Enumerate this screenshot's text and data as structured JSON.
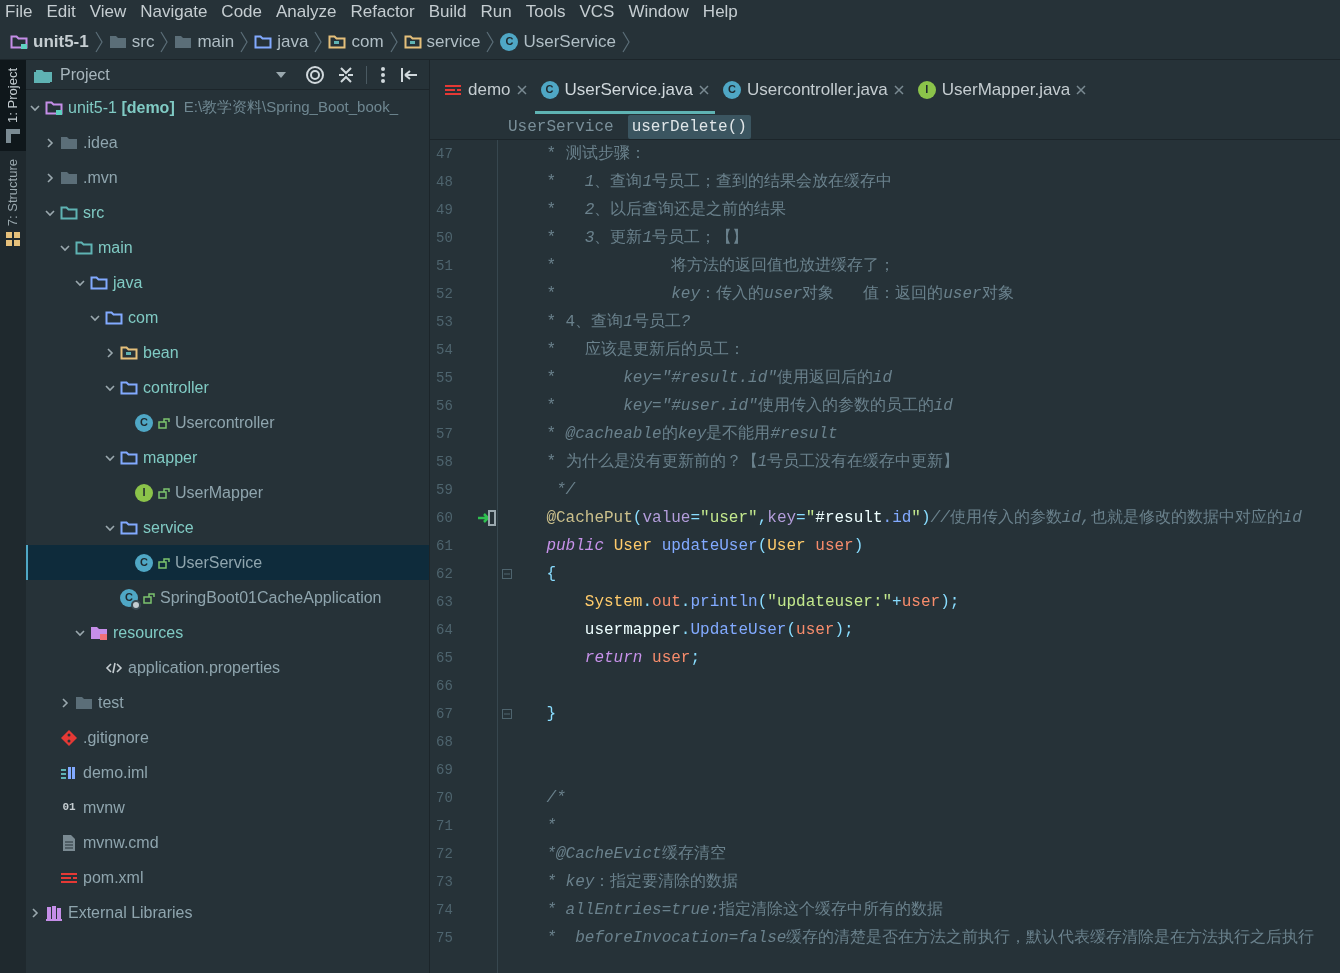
{
  "menu_bar": [
    "File",
    "Edit",
    "View",
    "Navigate",
    "Code",
    "Analyze",
    "Refactor",
    "Build",
    "Run",
    "Tools",
    "VCS",
    "Window",
    "Help"
  ],
  "breadcrumb": [
    {
      "label": "unit5-1",
      "kind": "module"
    },
    {
      "label": "src",
      "kind": "folder"
    },
    {
      "label": "main",
      "kind": "folder"
    },
    {
      "label": "java",
      "kind": "java-folder"
    },
    {
      "label": "com",
      "kind": "package"
    },
    {
      "label": "service",
      "kind": "package"
    },
    {
      "label": "UserService",
      "kind": "class",
      "badge": "C"
    }
  ],
  "side_tabs": [
    {
      "label": "1: Project",
      "selected": true
    },
    {
      "label": "7: Structure",
      "selected": false
    }
  ],
  "project_panel": {
    "title": "Project",
    "tree": [
      {
        "label": "unit5-1 **[demo]**",
        "path": "E:\\教学资料\\Spring_Boot_book_",
        "kind": "module",
        "expanded": true,
        "selected": false,
        "children": [
          {
            "label": ".idea",
            "kind": "folder",
            "expanded": false,
            "selected": false
          },
          {
            "label": ".mvn",
            "kind": "folder",
            "expanded": false,
            "selected": false
          },
          {
            "label": "src",
            "kind": "src-folder",
            "expanded": true,
            "selected": false,
            "children": [
              {
                "label": "main",
                "kind": "src-folder",
                "expanded": true,
                "selected": false,
                "children": [
                  {
                    "label": "java",
                    "kind": "java-folder",
                    "expanded": true,
                    "selected": false,
                    "children": [
                      {
                        "label": "com",
                        "kind": "java-folder",
                        "expanded": true,
                        "selected": false,
                        "children": [
                          {
                            "label": "bean",
                            "kind": "package",
                            "expanded": false,
                            "selected": false
                          },
                          {
                            "label": "controller",
                            "kind": "java-folder",
                            "expanded": true,
                            "selected": false,
                            "children": [
                              {
                                "label": "Usercontroller",
                                "kind": "class",
                                "badge": "C",
                                "selected": false
                              }
                            ]
                          },
                          {
                            "label": "mapper",
                            "kind": "java-folder",
                            "expanded": true,
                            "selected": false,
                            "children": [
                              {
                                "label": "UserMapper",
                                "kind": "interface",
                                "badge": "I",
                                "selected": false
                              }
                            ]
                          },
                          {
                            "label": "service",
                            "kind": "java-folder",
                            "expanded": true,
                            "selected": false,
                            "children": [
                              {
                                "label": "UserService",
                                "kind": "class",
                                "badge": "C",
                                "selected": true
                              }
                            ]
                          },
                          {
                            "label": "SpringBoot01CacheApplication",
                            "kind": "app",
                            "badge": "C",
                            "selected": false
                          }
                        ]
                      }
                    ]
                  },
                  {
                    "label": "resources",
                    "kind": "resources",
                    "expanded": true,
                    "selected": false,
                    "children": [
                      {
                        "label": "application.properties",
                        "kind": "properties",
                        "selected": false
                      }
                    ]
                  }
                ]
              },
              {
                "label": "test",
                "kind": "folder",
                "expanded": false,
                "selected": false
              }
            ]
          },
          {
            "label": ".gitignore",
            "kind": "git",
            "selected": false
          },
          {
            "label": "demo.iml",
            "kind": "iml",
            "selected": false
          },
          {
            "label": "mvnw",
            "kind": "binary",
            "badge": "01",
            "selected": false
          },
          {
            "label": "mvnw.cmd",
            "kind": "file",
            "selected": false
          },
          {
            "label": "pom.xml",
            "kind": "maven",
            "selected": false
          }
        ]
      },
      {
        "label": "External Libraries",
        "kind": "libraries",
        "expanded": false,
        "selected": false
      }
    ]
  },
  "editor": {
    "tabs": [
      {
        "label": "demo",
        "kind": "maven",
        "selected": false
      },
      {
        "label": "UserService.java",
        "kind": "class",
        "badge": "C",
        "selected": true
      },
      {
        "label": "Usercontroller.java",
        "kind": "class",
        "badge": "C",
        "selected": false
      },
      {
        "label": "UserMapper.java",
        "kind": "interface",
        "badge": "I",
        "selected": false
      }
    ],
    "breadcrumb": [
      {
        "label": "UserService",
        "selected": false
      },
      {
        "label": "userDelete()",
        "selected": true
      }
    ],
    "lines": [
      {
        "number": "47",
        "segments": [
          {
            "kind": "comment",
            "text": "    * 测试步骤："
          }
        ]
      },
      {
        "number": "48",
        "segments": [
          {
            "kind": "comment",
            "text": "    *   "
          },
          {
            "kind": "comment_em",
            "text": "1"
          },
          {
            "kind": "comment",
            "text": "、查询"
          },
          {
            "kind": "comment_em",
            "text": "1"
          },
          {
            "kind": "comment",
            "text": "号员工；查到的结果会放在缓存中"
          }
        ]
      },
      {
        "number": "49",
        "segments": [
          {
            "kind": "comment",
            "text": "    *   "
          },
          {
            "kind": "comment_em",
            "text": "2"
          },
          {
            "kind": "comment",
            "text": "、以后查询还是之前的结果"
          }
        ]
      },
      {
        "number": "50",
        "segments": [
          {
            "kind": "comment",
            "text": "    *   "
          },
          {
            "kind": "comment_em",
            "text": "3"
          },
          {
            "kind": "comment",
            "text": "、更新"
          },
          {
            "kind": "comment_em",
            "text": "1"
          },
          {
            "kind": "comment",
            "text": "号员工；【】"
          }
        ]
      },
      {
        "number": "51",
        "segments": [
          {
            "kind": "comment",
            "text": "    *            将方法的返回值也放进缓存了；"
          }
        ]
      },
      {
        "number": "52",
        "segments": [
          {
            "kind": "comment",
            "text": "    *            "
          },
          {
            "kind": "comment_em",
            "text": "key"
          },
          {
            "kind": "comment",
            "text": "：传入的"
          },
          {
            "kind": "comment_em",
            "text": "user"
          },
          {
            "kind": "comment",
            "text": "对象   值：返回的"
          },
          {
            "kind": "comment_em",
            "text": "user"
          },
          {
            "kind": "comment",
            "text": "对象"
          }
        ]
      },
      {
        "number": "53",
        "segments": [
          {
            "kind": "comment",
            "text": "    * 4、查询"
          },
          {
            "kind": "comment_em",
            "text": "1"
          },
          {
            "kind": "comment",
            "text": "号员工"
          },
          {
            "kind": "comment_em",
            "text": "?"
          }
        ]
      },
      {
        "number": "54",
        "segments": [
          {
            "kind": "comment",
            "text": "    *   应该是更新后的员工："
          }
        ]
      },
      {
        "number": "55",
        "segments": [
          {
            "kind": "comment",
            "text": "    *       "
          },
          {
            "kind": "comment_em",
            "text": "key=\"#result.id\""
          },
          {
            "kind": "comment",
            "text": "使用返回后的"
          },
          {
            "kind": "comment_em",
            "text": "id"
          }
        ]
      },
      {
        "number": "56",
        "segments": [
          {
            "kind": "comment",
            "text": "    *       "
          },
          {
            "kind": "comment_em",
            "text": "key=\"#user.id\""
          },
          {
            "kind": "comment",
            "text": "使用传入的参数的员工的"
          },
          {
            "kind": "comment_em",
            "text": "id"
          }
        ]
      },
      {
        "number": "57",
        "segments": [
          {
            "kind": "comment",
            "text": "    * "
          },
          {
            "kind": "comment_em",
            "text": "@cacheable"
          },
          {
            "kind": "comment",
            "text": "的"
          },
          {
            "kind": "comment_em",
            "text": "key"
          },
          {
            "kind": "comment",
            "text": "是不能用"
          },
          {
            "kind": "comment_em",
            "text": "#result"
          }
        ]
      },
      {
        "number": "58",
        "segments": [
          {
            "kind": "comment",
            "text": "    * 为什么是没有更新前的？【"
          },
          {
            "kind": "comment_em",
            "text": "1"
          },
          {
            "kind": "comment",
            "text": "号员工没有在缓存中更新】"
          }
        ]
      },
      {
        "number": "59",
        "segments": [
          {
            "kind": "comment_em",
            "text": "     */"
          }
        ]
      },
      {
        "number": "60",
        "kind": "run",
        "segments": [
          {
            "kind": "annotation",
            "text": "    @CachePut"
          },
          {
            "kind": "punct",
            "text": "("
          },
          {
            "kind": "attr",
            "text": "value"
          },
          {
            "kind": "punct",
            "text": "="
          },
          {
            "kind": "string",
            "text": "\"user\""
          },
          {
            "kind": "punct",
            "text": ","
          },
          {
            "kind": "attr",
            "text": "key"
          },
          {
            "kind": "punct",
            "text": "="
          },
          {
            "kind": "string",
            "text": "\""
          },
          {
            "kind": "plain",
            "text": "#result"
          },
          {
            "kind": "method",
            "text": ".id"
          },
          {
            "kind": "string",
            "text": "\""
          },
          {
            "kind": "punct",
            "text": ")"
          },
          {
            "kind": "comment_em",
            "text": "//"
          },
          {
            "kind": "comment",
            "text": "使用传入的参数"
          },
          {
            "kind": "comment_em",
            "text": "id,"
          },
          {
            "kind": "comment",
            "text": "也就是修改的数据中对应的"
          },
          {
            "kind": "comment_em",
            "text": "id"
          }
        ]
      },
      {
        "number": "61",
        "segments": [
          {
            "kind": "keyword",
            "text": "    public "
          },
          {
            "kind": "type",
            "text": "User "
          },
          {
            "kind": "method",
            "text": "updateUser"
          },
          {
            "kind": "punct",
            "text": "("
          },
          {
            "kind": "type",
            "text": "User "
          },
          {
            "kind": "param",
            "text": "user"
          },
          {
            "kind": "punct",
            "text": ")"
          }
        ]
      },
      {
        "number": "62",
        "kind": "fold",
        "segments": [
          {
            "kind": "punct",
            "text": "    {"
          }
        ]
      },
      {
        "number": "63",
        "segments": [
          {
            "kind": "type",
            "text": "        System"
          },
          {
            "kind": "punct",
            "text": "."
          },
          {
            "kind": "field",
            "text": "out"
          },
          {
            "kind": "punct",
            "text": "."
          },
          {
            "kind": "method",
            "text": "println"
          },
          {
            "kind": "punct",
            "text": "("
          },
          {
            "kind": "string",
            "text": "\"updateuser:\""
          },
          {
            "kind": "punct",
            "text": "+"
          },
          {
            "kind": "param",
            "text": "user"
          },
          {
            "kind": "punct",
            "text": ");"
          }
        ]
      },
      {
        "number": "64",
        "segments": [
          {
            "kind": "plain",
            "text": "        usermapper"
          },
          {
            "kind": "punct",
            "text": "."
          },
          {
            "kind": "method",
            "text": "UpdateUser"
          },
          {
            "kind": "punct",
            "text": "("
          },
          {
            "kind": "param",
            "text": "user"
          },
          {
            "kind": "punct",
            "text": ");"
          }
        ]
      },
      {
        "number": "65",
        "segments": [
          {
            "kind": "keyword",
            "text": "        return "
          },
          {
            "kind": "param",
            "text": "user"
          },
          {
            "kind": "punct",
            "text": ";"
          }
        ]
      },
      {
        "number": "66"
      },
      {
        "number": "67",
        "kind": "fold",
        "segments": [
          {
            "kind": "punct",
            "text": "    }"
          }
        ]
      },
      {
        "number": "68"
      },
      {
        "number": "69"
      },
      {
        "number": "70",
        "segments": [
          {
            "kind": "comment_em",
            "text": "    /*"
          }
        ]
      },
      {
        "number": "71",
        "segments": [
          {
            "kind": "comment_em",
            "text": "    *"
          }
        ]
      },
      {
        "number": "72",
        "segments": [
          {
            "kind": "comment_em",
            "text": "    *@CacheEvict"
          },
          {
            "kind": "comment",
            "text": "缓存清空"
          }
        ]
      },
      {
        "number": "73",
        "segments": [
          {
            "kind": "comment_em",
            "text": "    * key"
          },
          {
            "kind": "comment",
            "text": "：指定要清除的数据"
          }
        ]
      },
      {
        "number": "74",
        "segments": [
          {
            "kind": "comment_em",
            "text": "    * allEntries=true:"
          },
          {
            "kind": "comment",
            "text": "指定清除这个缓存中所有的数据"
          }
        ]
      },
      {
        "number": "75",
        "segments": [
          {
            "kind": "comment_em",
            "text": "    *  beforeInvocation=false"
          },
          {
            "kind": "comment",
            "text": "缓存的清楚是否在方法之前执行，默认代表缓存清除是在方法执行之后执行"
          }
        ]
      }
    ]
  }
}
